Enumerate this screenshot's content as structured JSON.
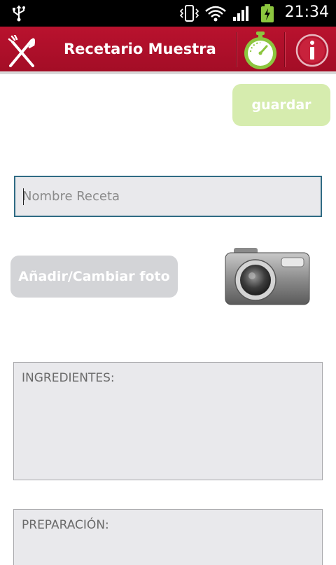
{
  "status_bar": {
    "time": "21:34"
  },
  "app_bar": {
    "title": "Recetario Muestra",
    "icons": {
      "logo": "fork-knife-icon",
      "timer": "stopwatch-icon",
      "info": "info-icon"
    }
  },
  "form": {
    "save_label": "guardar",
    "recipe_name_placeholder": "Nombre Receta",
    "photo_button_label": "Añadir/Cambiar foto",
    "ingredients_placeholder": "INGREDIENTES:",
    "preparation_placeholder": "PREPARACIÓN:"
  },
  "colors": {
    "app_bar": "#b9122e",
    "save_button": "#d6ecae",
    "timer_green": "#8cc63f",
    "input_focus_border": "#2f6b84"
  }
}
